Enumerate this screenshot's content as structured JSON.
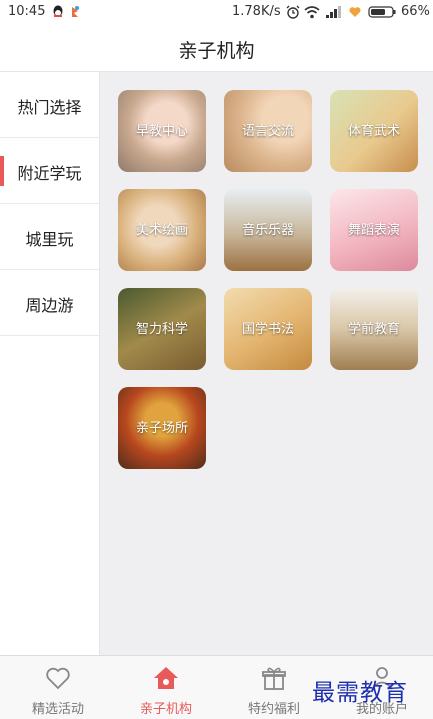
{
  "status_bar": {
    "time": "10:45",
    "network_speed": "1.78K/s",
    "battery_percent": "66%"
  },
  "header": {
    "title": "亲子机构"
  },
  "sidebar": {
    "items": [
      {
        "label": "热门选择",
        "active": false
      },
      {
        "label": "附近学玩",
        "active": true
      },
      {
        "label": "城里玩",
        "active": false
      },
      {
        "label": "周边游",
        "active": false
      }
    ]
  },
  "categories": [
    {
      "label": "早教中心"
    },
    {
      "label": "语言交流"
    },
    {
      "label": "体育武术"
    },
    {
      "label": "美术绘画"
    },
    {
      "label": "音乐乐器"
    },
    {
      "label": "舞蹈表演"
    },
    {
      "label": "智力科学"
    },
    {
      "label": "国学书法"
    },
    {
      "label": "学前教育"
    },
    {
      "label": "亲子场所"
    }
  ],
  "tab_bar": {
    "tabs": [
      {
        "label": "精选活动",
        "icon": "heart-icon",
        "active": false
      },
      {
        "label": "亲子机构",
        "icon": "home-icon",
        "active": true
      },
      {
        "label": "特约福利",
        "icon": "gift-icon",
        "active": false
      },
      {
        "label": "我的账户",
        "icon": "user-icon",
        "active": false
      }
    ]
  },
  "watermark": "最需教育",
  "colors": {
    "accent": "#e85a5a",
    "content_bg": "#efeff1",
    "watermark": "#1d2fae"
  }
}
